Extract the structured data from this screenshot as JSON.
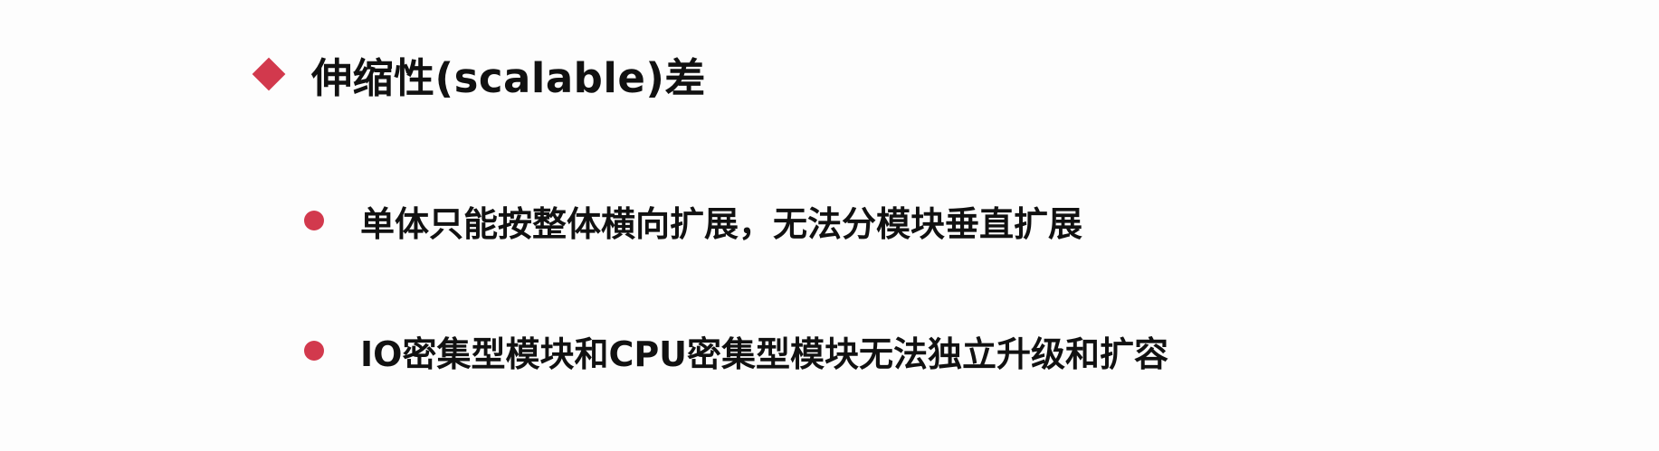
{
  "heading": {
    "text": "伸缩性(scalable)差",
    "bullet_color": "#d2394d"
  },
  "points": [
    {
      "text": "单体只能按整体横向扩展，无法分模块垂直扩展"
    },
    {
      "text": "IO密集型模块和CPU密集型模块无法独立升级和扩容"
    }
  ],
  "colors": {
    "accent": "#d2394d",
    "text": "#111111",
    "background": "#fdfdfd"
  }
}
